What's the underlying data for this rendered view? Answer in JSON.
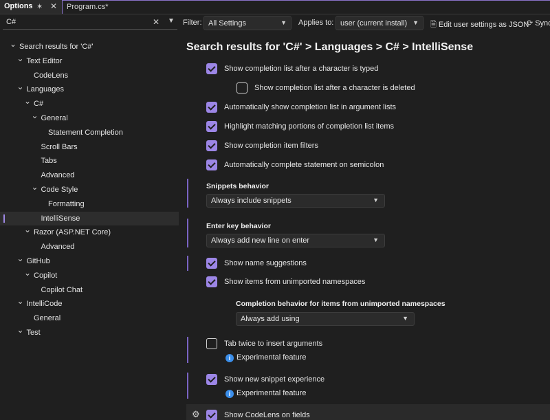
{
  "tabs": {
    "options_title": "Options",
    "pin_icon": "✶",
    "close_icon": "✕",
    "program_title": "Program.cs*"
  },
  "toolbar": {
    "search_value": "C#",
    "filter_label": "Filter:",
    "filter_value": "All Settings",
    "applies_label": "Applies to:",
    "applies_value": "user (current install)",
    "edit_json_label": "Edit user settings as JSON",
    "sync_label": "Sync"
  },
  "tree": [
    {
      "label": "Search results for 'C#'",
      "level": 0,
      "expanded": true
    },
    {
      "label": "Text Editor",
      "level": 1,
      "expanded": true
    },
    {
      "label": "CodeLens",
      "level": 2,
      "expanded": null
    },
    {
      "label": "Languages",
      "level": 1,
      "expanded": true
    },
    {
      "label": "C#",
      "level": 2,
      "expanded": true
    },
    {
      "label": "General",
      "level": 3,
      "expanded": true
    },
    {
      "label": "Statement Completion",
      "level": 4,
      "expanded": null
    },
    {
      "label": "Scroll Bars",
      "level": 3,
      "expanded": null
    },
    {
      "label": "Tabs",
      "level": 3,
      "expanded": null
    },
    {
      "label": "Advanced",
      "level": 3,
      "expanded": null
    },
    {
      "label": "Code Style",
      "level": 3,
      "expanded": true
    },
    {
      "label": "Formatting",
      "level": 4,
      "expanded": null
    },
    {
      "label": "IntelliSense",
      "level": 3,
      "expanded": null,
      "selected": true
    },
    {
      "label": "Razor (ASP.NET Core)",
      "level": 2,
      "expanded": true
    },
    {
      "label": "Advanced",
      "level": 3,
      "expanded": null
    },
    {
      "label": "GitHub",
      "level": 1,
      "expanded": true
    },
    {
      "label": "Copilot",
      "level": 2,
      "expanded": true
    },
    {
      "label": "Copilot Chat",
      "level": 3,
      "expanded": null
    },
    {
      "label": "IntelliCode",
      "level": 1,
      "expanded": true
    },
    {
      "label": "General",
      "level": 2,
      "expanded": null
    },
    {
      "label": "Test",
      "level": 1,
      "expanded": true
    }
  ],
  "content": {
    "title": "Search results for 'C#' > Languages > C# > IntelliSense",
    "settings": {
      "s1": {
        "label": "Show completion list after a character is typed",
        "checked": true
      },
      "s2": {
        "label": "Show completion list after a character is deleted",
        "checked": false
      },
      "s3": {
        "label": "Automatically show completion list in argument lists",
        "checked": true
      },
      "s4": {
        "label": "Highlight matching portions of completion list items",
        "checked": true
      },
      "s5": {
        "label": "Show completion item filters",
        "checked": true
      },
      "s6": {
        "label": "Automatically complete statement on semicolon",
        "checked": true
      },
      "s7": {
        "label": "Show name suggestions",
        "checked": true
      },
      "s8": {
        "label": "Show items from unimported namespaces",
        "checked": true
      },
      "s9": {
        "label": "Tab twice to insert arguments",
        "checked": false
      },
      "s10": {
        "label": "Show new snippet experience",
        "checked": true
      },
      "s11": {
        "label": "Show CodeLens on fields",
        "checked": true
      }
    },
    "snippets": {
      "label": "Snippets behavior",
      "value": "Always include snippets"
    },
    "enter_key": {
      "label": "Enter key behavior",
      "value": "Always add new line on enter"
    },
    "completion_behavior": {
      "label": "Completion behavior for items from unimported namespaces",
      "value": "Always add using"
    },
    "experimental_label": "Experimental feature",
    "experimental_label_2": "Experimental feature"
  },
  "colors": {
    "accent": "#9c86e6",
    "background": "#1f1f1f",
    "info": "#3b8eea"
  }
}
